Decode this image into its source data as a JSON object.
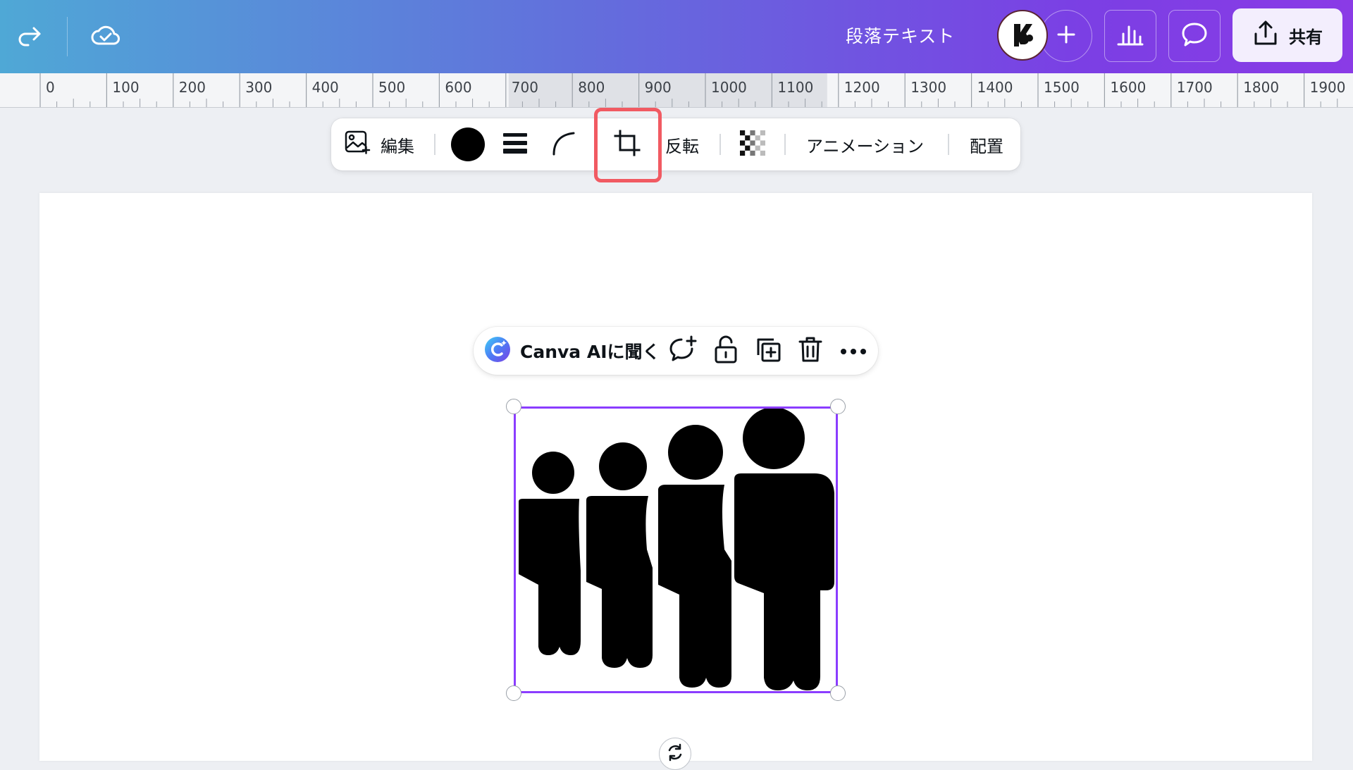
{
  "topbar": {
    "doc_title": "段落テキスト",
    "share_label": "共有",
    "icons": [
      "redo-icon",
      "cloud-check-icon",
      "plus-icon",
      "bar-chart-icon",
      "comment-icon",
      "upload-icon"
    ],
    "gradient_colors": [
      "#4fa8d6",
      "#6270dc",
      "#7b3fe4",
      "#8a3be6"
    ]
  },
  "ruler": {
    "labels": [
      "0",
      "100",
      "200",
      "300",
      "400",
      "500",
      "600",
      "700",
      "800",
      "900",
      "1000",
      "1100",
      "1200",
      "1300",
      "1400",
      "1500",
      "1600",
      "1700",
      "1800",
      "1900"
    ],
    "selected_range": [
      700,
      1200
    ]
  },
  "context_toolbar": {
    "edit_label": "編集",
    "flip_label": "反転",
    "animation_label": "アニメーション",
    "position_label": "配置",
    "color": "#000000",
    "icons": [
      "edit-image-icon",
      "color-swatch",
      "line-style-icon",
      "corner-rounding-icon",
      "crop-icon",
      "transparency-icon"
    ]
  },
  "floating_toolbar": {
    "ai_label": "Canva AIに聞く",
    "icons": [
      "canva-ai-icon",
      "add-comment-icon",
      "lock-icon",
      "duplicate-icon",
      "trash-icon",
      "more-icon"
    ]
  },
  "colors": {
    "accent": "#8b3dff",
    "highlight": "#f15a62",
    "canvas_bg": "#edeff3"
  }
}
